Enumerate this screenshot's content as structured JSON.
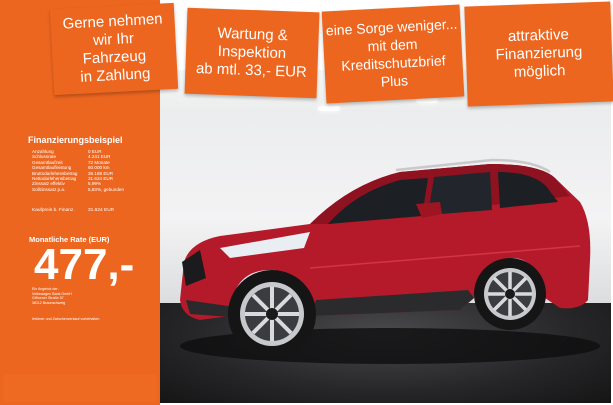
{
  "banners": [
    {
      "text": "Gerne nehmen\nwir Ihr\nFahrzeug\nin Zahlung"
    },
    {
      "text": "Wartung &\nInspektion\nab mtl. 33,- EUR"
    },
    {
      "text": "eine Sorge weniger...\nmit dem\nKreditschutzbrief\nPlus"
    },
    {
      "text": "attraktive\nFinanzierung\nmöglich"
    }
  ],
  "financing": {
    "title": "Finanzierungsbeispiel",
    "rows": [
      {
        "label": "Anzahlung",
        "value": "0 EUR"
      },
      {
        "label": "Schlussrate",
        "value": "4.241 EUR"
      },
      {
        "label": "Gesamtlaufzeit",
        "value": "72 Monate"
      },
      {
        "label": "Gesamtlaufleistung",
        "value": "60.000 km"
      },
      {
        "label": "Bruttodarlehensbetrag",
        "value": "36.188 EUR"
      },
      {
        "label": "Nettodarlehensbetrag",
        "value": "31.624 EUR"
      },
      {
        "label": "Zinssatz effektiv",
        "value": "5,99%"
      },
      {
        "label": "Sollzinssatz p.a.",
        "value": "5,83%, gebunden"
      }
    ],
    "kaufpreis_label": "Kaufpreis b. Finanz.",
    "kaufpreis_value": "31.624 EUR",
    "rate_label": "Monatliche Rate (EUR)",
    "rate_value": "477,-",
    "dealer": "Ein Angebot der:\nVolkswagen Bank GmbH\nGifhorner Straße 57\n38112 Braunschweig",
    "footnote": "Irrtümer und Zwischenverkauf vorbehalten"
  },
  "colors": {
    "accent": "#ec6620",
    "car_body": "#b41a2a"
  }
}
